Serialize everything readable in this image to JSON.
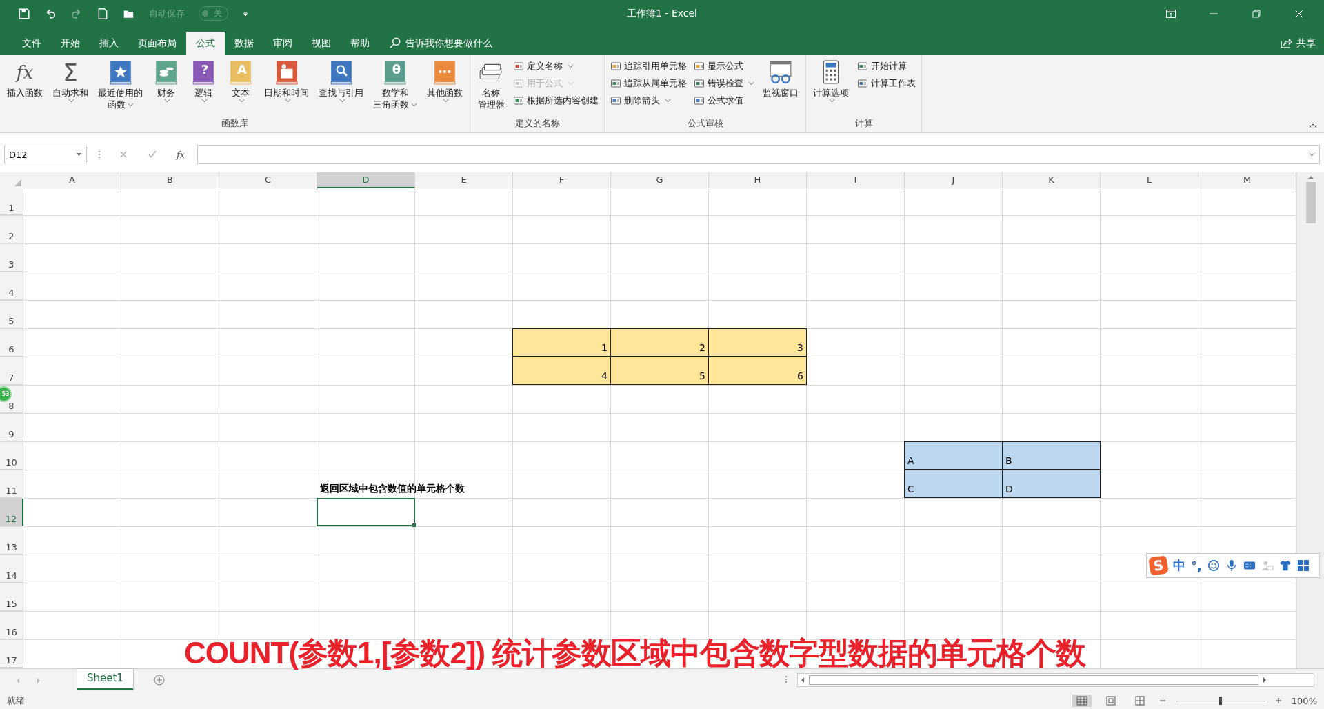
{
  "title_bar": {
    "title": "工作簿1  -  Excel",
    "autosave": {
      "label": "自动保存",
      "state": "关",
      "on": false
    }
  },
  "menu_tabs": [
    {
      "label": "文件",
      "selected": false
    },
    {
      "label": "开始",
      "selected": false
    },
    {
      "label": "插入",
      "selected": false
    },
    {
      "label": "页面布局",
      "selected": false
    },
    {
      "label": "公式",
      "selected": true
    },
    {
      "label": "数据",
      "selected": false
    },
    {
      "label": "审阅",
      "selected": false
    },
    {
      "label": "视图",
      "selected": false
    },
    {
      "label": "帮助",
      "selected": false
    }
  ],
  "tell_me": "告诉我你想要做什么",
  "share": "共享",
  "ribbon_groups": [
    {
      "label": "函数库",
      "controls": [
        {
          "kind": "large",
          "lines": [
            "插入函数"
          ],
          "glyph": "fx",
          "dropdown": false
        },
        {
          "kind": "large",
          "lines": [
            "自动求和"
          ],
          "glyph": "Σ",
          "dropdown": true
        },
        {
          "kind": "large",
          "lines": [
            "最近使用的",
            "函数"
          ],
          "dropdown": true
        },
        {
          "kind": "large",
          "lines": [
            "财务"
          ],
          "dropdown": true
        },
        {
          "kind": "large",
          "lines": [
            "逻辑"
          ],
          "glyph": "?",
          "dropdown": true
        },
        {
          "kind": "large",
          "lines": [
            "文本"
          ],
          "glyph": "A",
          "dropdown": true
        },
        {
          "kind": "large",
          "lines": [
            "日期和时间"
          ],
          "dropdown": true
        },
        {
          "kind": "large",
          "lines": [
            "查找与引用"
          ],
          "dropdown": true
        },
        {
          "kind": "large",
          "lines": [
            "数学和",
            "三角函数"
          ],
          "glyph": "θ",
          "dropdown": true
        },
        {
          "kind": "large",
          "lines": [
            "其他函数"
          ],
          "dropdown": true
        }
      ]
    },
    {
      "label": "定义的名称",
      "controls": [
        {
          "kind": "large",
          "lines": [
            "名称",
            "管理器"
          ],
          "dropdown": false
        },
        {
          "kind": "stack",
          "items": [
            {
              "label": "定义名称",
              "dropdown": true,
              "disabled": false
            },
            {
              "label": "用于公式",
              "dropdown": true,
              "disabled": true
            },
            {
              "label": "根据所选内容创建",
              "dropdown": false,
              "disabled": false
            }
          ]
        }
      ]
    },
    {
      "label": "公式审核",
      "controls": [
        {
          "kind": "stack",
          "items": [
            {
              "label": "追踪引用单元格",
              "dropdown": false,
              "disabled": false
            },
            {
              "label": "追踪从属单元格",
              "dropdown": false,
              "disabled": false
            },
            {
              "label": "删除箭头",
              "dropdown": true,
              "disabled": false
            }
          ]
        },
        {
          "kind": "stack",
          "items": [
            {
              "label": "显示公式",
              "dropdown": false,
              "disabled": false
            },
            {
              "label": "错误检查",
              "dropdown": true,
              "disabled": false
            },
            {
              "label": "公式求值",
              "dropdown": false,
              "disabled": false
            }
          ]
        },
        {
          "kind": "large",
          "lines": [
            "监视窗口"
          ],
          "dropdown": false
        }
      ]
    },
    {
      "label": "计算",
      "controls": [
        {
          "kind": "large",
          "lines": [
            "计算选项"
          ],
          "dropdown": true
        },
        {
          "kind": "stack",
          "items": [
            {
              "label": "开始计算",
              "dropdown": false,
              "disabled": false
            },
            {
              "label": "计算工作表",
              "dropdown": false,
              "disabled": false
            }
          ]
        }
      ]
    }
  ],
  "formula_bar": {
    "name_box": "D12",
    "fx": "fx"
  },
  "columns": [
    {
      "label": "A",
      "selected": false
    },
    {
      "label": "B",
      "selected": false
    },
    {
      "label": "C",
      "selected": false
    },
    {
      "label": "D",
      "selected": true
    },
    {
      "label": "E",
      "selected": false
    },
    {
      "label": "F",
      "selected": false
    },
    {
      "label": "G",
      "selected": false
    },
    {
      "label": "H",
      "selected": false
    },
    {
      "label": "I",
      "selected": false
    },
    {
      "label": "J",
      "selected": false
    },
    {
      "label": "K",
      "selected": false
    },
    {
      "label": "L",
      "selected": false
    },
    {
      "label": "M",
      "selected": false
    }
  ],
  "rows": [
    {
      "label": "1",
      "selected": false
    },
    {
      "label": "2",
      "selected": false
    },
    {
      "label": "3",
      "selected": false
    },
    {
      "label": "4",
      "selected": false
    },
    {
      "label": "5",
      "selected": false
    },
    {
      "label": "6",
      "selected": false,
      "cells": {
        "F": {
          "value": "1",
          "kind": "number",
          "color": "#ffe699"
        },
        "G": {
          "value": "2",
          "kind": "number",
          "color": "#ffe699"
        },
        "H": {
          "value": "3",
          "kind": "number",
          "color": "#ffe699"
        }
      }
    },
    {
      "label": "7",
      "selected": false,
      "cells": {
        "F": {
          "value": "4",
          "kind": "number",
          "color": "#ffe699"
        },
        "G": {
          "value": "5",
          "kind": "number",
          "color": "#ffe699"
        },
        "H": {
          "value": "6",
          "kind": "number",
          "color": "#ffe699"
        }
      }
    },
    {
      "label": "8",
      "selected": false
    },
    {
      "label": "9",
      "selected": false
    },
    {
      "label": "10",
      "selected": false,
      "cells": {
        "J": {
          "value": "A",
          "kind": "text",
          "color": "#bdd7ee"
        },
        "K": {
          "value": "B",
          "kind": "text",
          "color": "#bdd7ee"
        }
      }
    },
    {
      "label": "11",
      "selected": false,
      "cells": {
        "D": {
          "value": "返回区域中包含数值的单元格个数",
          "kind": "text",
          "bold": true
        },
        "J": {
          "value": "C",
          "kind": "text",
          "color": "#bdd7ee"
        },
        "K": {
          "value": "D",
          "kind": "text",
          "color": "#bdd7ee"
        }
      }
    },
    {
      "label": "12",
      "selected": true
    },
    {
      "label": "13",
      "selected": false
    },
    {
      "label": "14",
      "selected": false
    },
    {
      "label": "15",
      "selected": false
    },
    {
      "label": "16",
      "selected": false
    },
    {
      "label": "17",
      "selected": false
    }
  ],
  "sheet_tabs": [
    {
      "label": "Sheet1",
      "selected": true
    }
  ],
  "status_bar": {
    "status": "就绪",
    "zoom": "100%",
    "zoom_level": {
      "level": 0.5
    }
  },
  "caption": "COUNT(参数1,[参数2])  统计参数区域中包含数字型数据的单元格个数",
  "floating_badge": "53",
  "ime_toolbar": {
    "logo": "S",
    "mode": "中",
    "punctuation": "°,"
  }
}
